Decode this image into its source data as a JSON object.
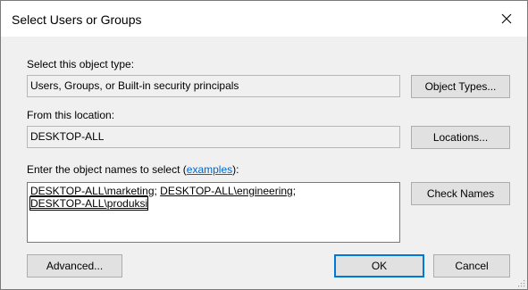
{
  "window": {
    "title": "Select Users or Groups"
  },
  "object_type": {
    "label": "Select this object type:",
    "value": "Users, Groups, or Built-in security principals",
    "button": "Object Types..."
  },
  "location": {
    "label": "From this location:",
    "value": "DESKTOP-ALL",
    "button": "Locations..."
  },
  "object_names": {
    "label_prefix": "Enter the object names to select (",
    "label_link": "examples",
    "label_suffix": "):",
    "names": [
      "DESKTOP-ALL\\marketing",
      "DESKTOP-ALL\\engineering",
      "DESKTOP-ALL\\produksi"
    ],
    "separator": "; ",
    "button": "Check Names"
  },
  "footer": {
    "advanced": "Advanced...",
    "ok": "OK",
    "cancel": "Cancel"
  },
  "colors": {
    "accent": "#0078d7",
    "link": "#0066cc",
    "dialog_bg": "#f0f0f0"
  },
  "icons": {
    "close": "close-icon",
    "resize": "resize-grip-icon"
  }
}
